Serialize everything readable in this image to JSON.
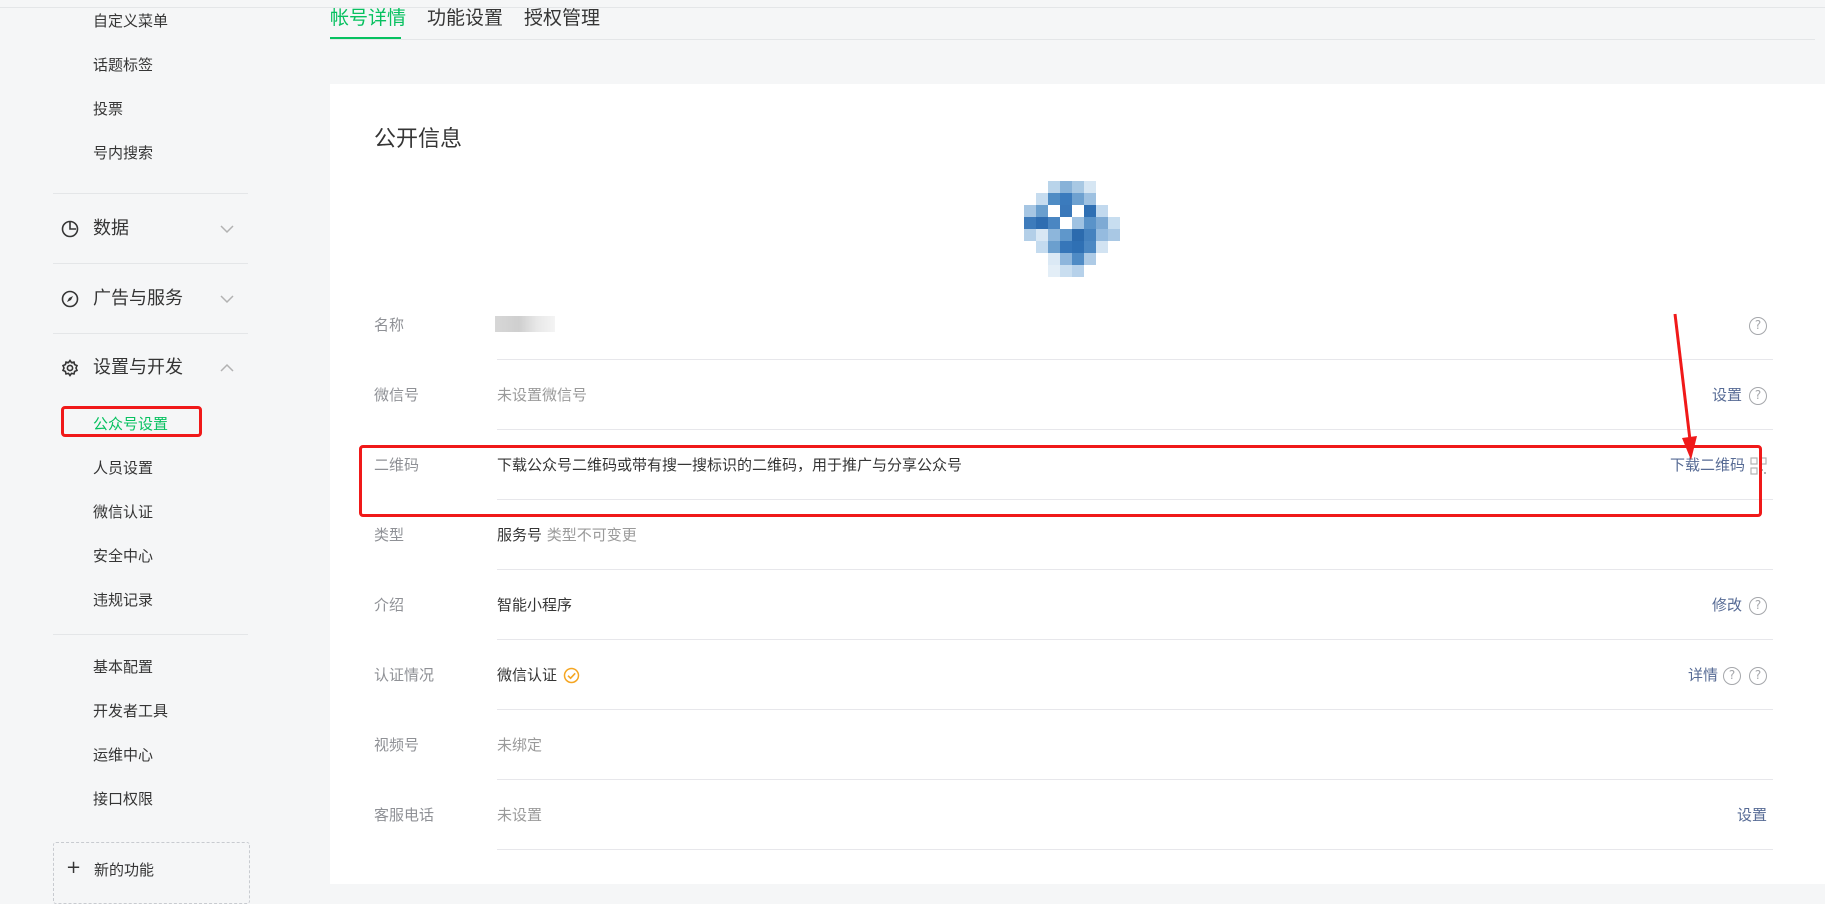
{
  "sidebar": {
    "top_items": [
      "自定义菜单",
      "话题标签",
      "投票",
      "号内搜索"
    ],
    "groups": [
      {
        "label": "数据",
        "icon": "pie-chart-icon",
        "expanded": false
      },
      {
        "label": "广告与服务",
        "icon": "compass-icon",
        "expanded": false
      },
      {
        "label": "设置与开发",
        "icon": "gear-icon",
        "expanded": true
      }
    ],
    "settings_items": [
      {
        "label": "公众号设置",
        "active": true
      },
      {
        "label": "人员设置",
        "active": false
      },
      {
        "label": "微信认证",
        "active": false
      },
      {
        "label": "安全中心",
        "active": false
      },
      {
        "label": "违规记录",
        "active": false
      }
    ],
    "dev_items": [
      "基本配置",
      "开发者工具",
      "运维中心",
      "接口权限"
    ],
    "add_label": "新的功能"
  },
  "tabs": [
    {
      "label": "帐号详情",
      "active": true
    },
    {
      "label": "功能设置",
      "active": false
    },
    {
      "label": "授权管理",
      "active": false
    }
  ],
  "section_title": "公开信息",
  "rows": {
    "name": {
      "label": "名称"
    },
    "wechat_id": {
      "label": "微信号",
      "value": "未设置微信号",
      "action": "设置"
    },
    "qrcode": {
      "label": "二维码",
      "value": "下载公众号二维码或带有搜一搜标识的二维码，用于推广与分享公众号",
      "action": "下载二维码"
    },
    "type": {
      "label": "类型",
      "value": "服务号",
      "note": "类型不可变更"
    },
    "intro": {
      "label": "介绍",
      "value": "智能小程序",
      "action": "修改"
    },
    "verify": {
      "label": "认证情况",
      "value": "微信认证",
      "action": "详情"
    },
    "channels": {
      "label": "视频号",
      "value": "未绑定"
    },
    "phone": {
      "label": "客服电话",
      "value": "未设置",
      "action": "设置"
    }
  },
  "colors": {
    "accent": "#07c160",
    "link": "#576b95",
    "highlight": "#f01919",
    "verified": "#f5a623"
  }
}
